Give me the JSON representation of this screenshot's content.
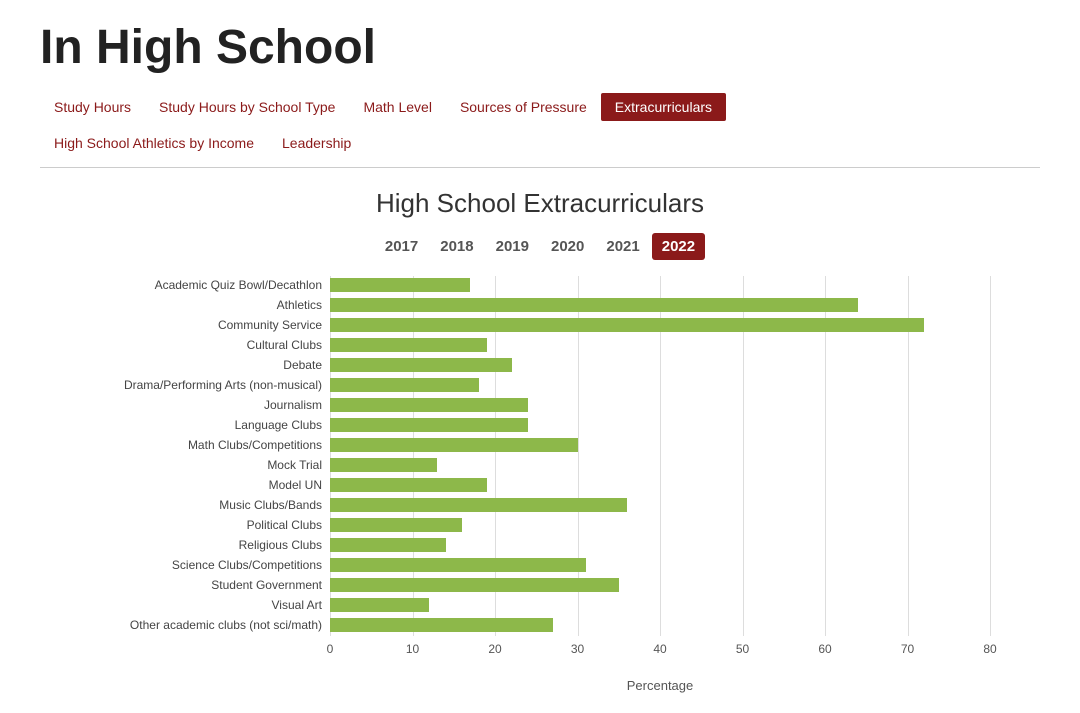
{
  "page": {
    "title": "In High School"
  },
  "nav": {
    "items": [
      {
        "id": "study-hours",
        "label": "Study Hours",
        "active": false
      },
      {
        "id": "study-hours-school-type",
        "label": "Study Hours by School Type",
        "active": false
      },
      {
        "id": "math-level",
        "label": "Math Level",
        "active": false
      },
      {
        "id": "sources-of-pressure",
        "label": "Sources of Pressure",
        "active": false
      },
      {
        "id": "extracurriculars",
        "label": "Extracurriculars",
        "active": true
      },
      {
        "id": "athletics-by-income",
        "label": "High School Athletics by Income",
        "active": false
      },
      {
        "id": "leadership",
        "label": "Leadership",
        "active": false
      }
    ]
  },
  "chart": {
    "title": "High School Extracurriculars",
    "years": [
      {
        "label": "2017",
        "active": false
      },
      {
        "label": "2018",
        "active": false
      },
      {
        "label": "2019",
        "active": false
      },
      {
        "label": "2020",
        "active": false
      },
      {
        "label": "2021",
        "active": false
      },
      {
        "label": "2022",
        "active": true
      }
    ],
    "x_axis_label": "Percentage",
    "x_ticks": [
      0,
      10,
      20,
      30,
      40,
      50,
      60,
      70,
      80
    ],
    "x_max": 80,
    "bars": [
      {
        "label": "Academic Quiz Bowl/Decathlon",
        "value": 17
      },
      {
        "label": "Athletics",
        "value": 64
      },
      {
        "label": "Community Service",
        "value": 72
      },
      {
        "label": "Cultural Clubs",
        "value": 19
      },
      {
        "label": "Debate",
        "value": 22
      },
      {
        "label": "Drama/Performing Arts (non-musical)",
        "value": 18
      },
      {
        "label": "Journalism",
        "value": 24
      },
      {
        "label": "Language Clubs",
        "value": 24
      },
      {
        "label": "Math Clubs/Competitions",
        "value": 30
      },
      {
        "label": "Mock Trial",
        "value": 13
      },
      {
        "label": "Model UN",
        "value": 19
      },
      {
        "label": "Music Clubs/Bands",
        "value": 36
      },
      {
        "label": "Political Clubs",
        "value": 16
      },
      {
        "label": "Religious Clubs",
        "value": 14
      },
      {
        "label": "Science Clubs/Competitions",
        "value": 31
      },
      {
        "label": "Student Government",
        "value": 35
      },
      {
        "label": "Visual Art",
        "value": 12
      },
      {
        "label": "Other academic clubs (not sci/math)",
        "value": 27
      }
    ]
  }
}
